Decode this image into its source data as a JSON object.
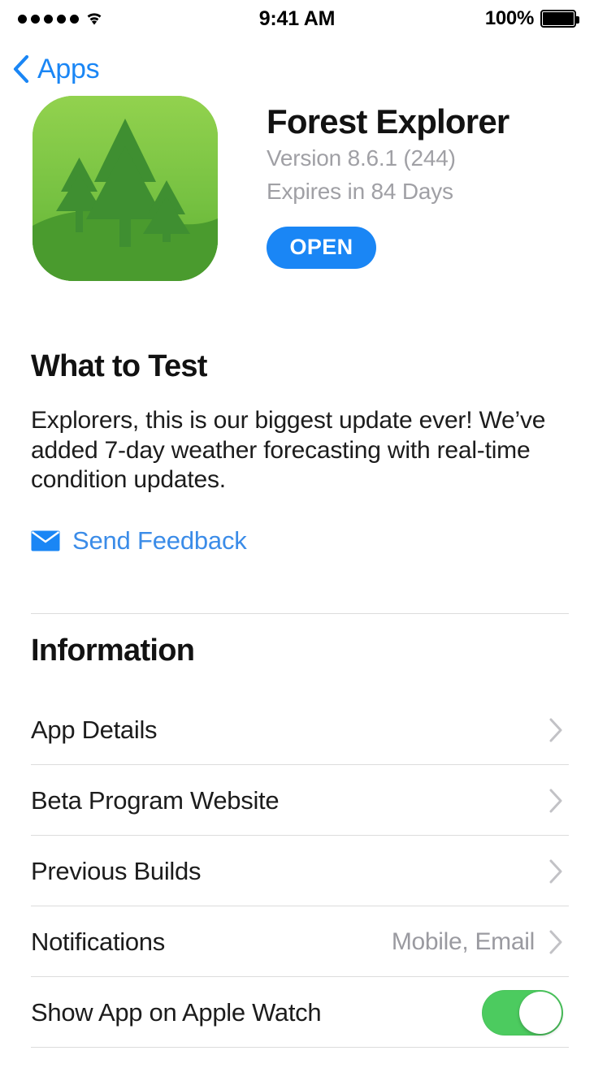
{
  "status_bar": {
    "signal_dots": 5,
    "wifi_icon": "wifi-icon",
    "time": "9:41 AM",
    "battery_percent": "100%",
    "battery_icon": "battery-full-icon"
  },
  "nav": {
    "back_icon": "chevron-left-icon",
    "back_label": "Apps"
  },
  "app": {
    "icon_name": "forest-explorer-app-icon",
    "title": "Forest Explorer",
    "version": "Version 8.6.1 (244)",
    "expires": "Expires in 84 Days",
    "open_label": "OPEN"
  },
  "what_to_test": {
    "heading": "What to Test",
    "notes": "Explorers, this is our biggest update ever! We’ve added 7-day weather forecasting with real-time condition updates.",
    "feedback_icon": "envelope-icon",
    "feedback_label": "Send Feedback"
  },
  "information": {
    "heading": "Information",
    "rows": [
      {
        "label": "App Details",
        "value": "",
        "accessory": "chevron-right-icon"
      },
      {
        "label": "Beta Program Website",
        "value": "",
        "accessory": "chevron-right-icon"
      },
      {
        "label": "Previous Builds",
        "value": "",
        "accessory": "chevron-right-icon"
      },
      {
        "label": "Notifications",
        "value": "Mobile, Email",
        "accessory": "chevron-right-icon"
      },
      {
        "label": "Show App on Apple Watch",
        "value": "",
        "accessory": "toggle-on"
      }
    ]
  },
  "colors": {
    "accent_blue": "#1a86f5",
    "link_blue": "#3b8ce8",
    "toggle_green": "#4ccb5f",
    "text_primary": "#1c1c1c",
    "text_secondary": "#9a9aa0",
    "separator": "#dcdcdc",
    "icon_green_light": "#8ed04a",
    "icon_green_dark": "#3f8f31"
  }
}
